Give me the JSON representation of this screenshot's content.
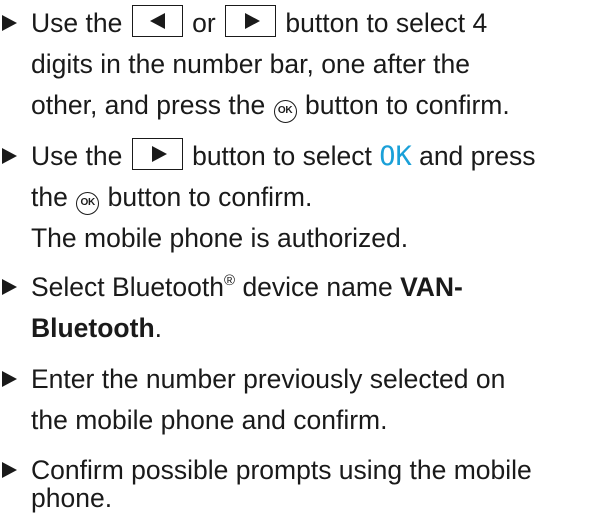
{
  "steps": [
    {
      "lines": [
        {
          "a": "Use the",
          "b": "or",
          "c": "button to select 4"
        },
        {
          "text": "digits in the number bar, one after the"
        },
        {
          "a": "other, and press the",
          "ok": "OK",
          "c": "button to confirm."
        }
      ]
    },
    {
      "lines": [
        {
          "a": "Use the",
          "b": "button to select",
          "display": "OK",
          "c": "and press"
        },
        {
          "a": "the",
          "ok": "OK",
          "c": "button to confirm."
        },
        {
          "text": "The mobile phone is authorized."
        }
      ]
    },
    {
      "lines": [
        {
          "a": "Select Bluetooth",
          "reg": "®",
          "b": "device name",
          "bold1": "VAN-"
        },
        {
          "bold2": "Bluetooth",
          "c": "."
        }
      ]
    },
    {
      "lines": [
        {
          "text": "Enter the number previously selected on"
        },
        {
          "text": "the mobile phone and confirm."
        }
      ]
    },
    {
      "lines": [
        {
          "text": "Confirm possible prompts using the mobile"
        },
        {
          "text": "phone."
        }
      ]
    }
  ],
  "icons": {
    "bullet": "triangle-right-icon",
    "left_key": "left-arrow-button-icon",
    "right_key": "right-arrow-button-icon",
    "ok_button": "ok-button-icon"
  }
}
